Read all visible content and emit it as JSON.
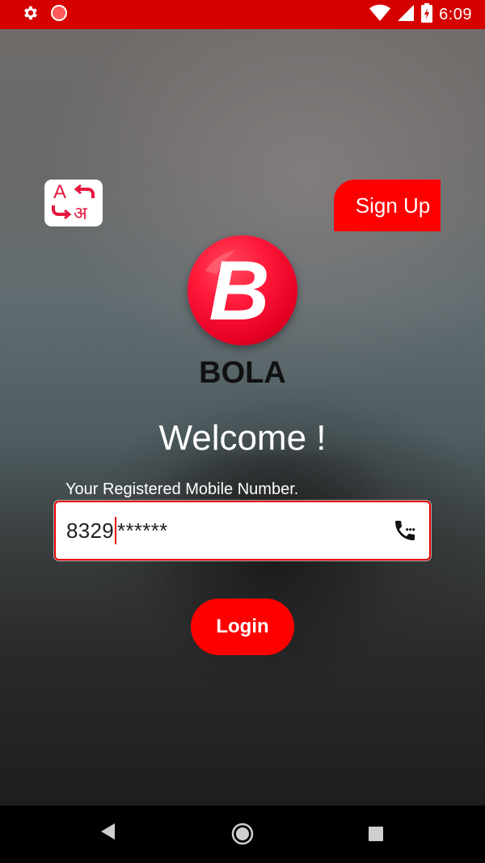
{
  "status_bar": {
    "time": "6:09",
    "background": "#d50000",
    "icons": [
      "settings-icon",
      "record-icon",
      "wifi-icon",
      "signal-icon",
      "battery-icon"
    ]
  },
  "top": {
    "translate_icon": "translate-icon",
    "signup_label": "Sign Up"
  },
  "brand": {
    "logo_letter": "B",
    "name": "BOLA"
  },
  "welcome_text": "Welcome !",
  "mobile": {
    "label": "Your Registered Mobile Number.",
    "value_visible": "8329",
    "value_masked": "******",
    "contact_icon": "phone-contacts-icon"
  },
  "login_label": "Login",
  "colors": {
    "accent": "#ff0000",
    "status_bar": "#d50000"
  },
  "nav_bar": {
    "buttons": [
      "back-icon",
      "home-icon",
      "recents-icon"
    ]
  }
}
